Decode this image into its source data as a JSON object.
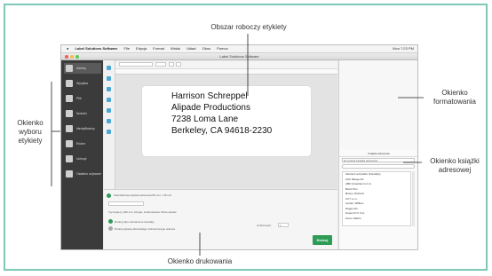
{
  "annotations": {
    "workspace": "Obszar roboczy etykiety",
    "label_selection": [
      "Okienko",
      "wyboru",
      "etykiety"
    ],
    "formatting": [
      "Okienko",
      "formatowania"
    ],
    "address_book": [
      "Okienko książki",
      "adresowej"
    ],
    "print": "Okienko drukowania"
  },
  "menubar": {
    "app": "Label Solutions Software",
    "items": [
      "File",
      "Edycja",
      "Format",
      "Widok",
      "Układ",
      "Okno",
      "Pomoc"
    ],
    "status": "Mon 7:23 PM"
  },
  "window": {
    "title": "Label Solutions Software"
  },
  "sidebar": {
    "items": [
      {
        "label": "Adresy",
        "icon": "address-icon"
      },
      {
        "label": "Wysyłka",
        "icon": "shipping-icon"
      },
      {
        "label": "Plik",
        "icon": "file-icon"
      },
      {
        "label": "Nośniki",
        "icon": "media-icon"
      },
      {
        "label": "Identyfikatory",
        "icon": "id-icon"
      },
      {
        "label": "Różne",
        "icon": "misc-icon"
      },
      {
        "label": "Uchwyt",
        "icon": "holder-icon"
      },
      {
        "label": "Ostatnio używane",
        "icon": "recent-icon"
      }
    ]
  },
  "label": {
    "lines": [
      "Harrison Schreppel",
      "Alipade Productions",
      "7238 Loma Lane",
      "Berkeley, CA 94618-2230"
    ]
  },
  "address_book": {
    "header": "Książka adresowa",
    "selector": "Domyślna książka adresowa",
    "contacts": [
      "Zaznacz wszystkie (Kontakty)",
      "ACF Range AS",
      "ABF Industries G.C.A.",
      "Bond PLC",
      "Brown, Richard",
      "CCY s.r.o.",
      "Carrier, William",
      "Dagos AG",
      "Dupont P.V. S.A.",
      "Kevin, Martin"
    ]
  },
  "print_pane": {
    "media": "Standardowa etykieta adresowa 89 mm × 28 mm",
    "printer_line": "Typ kopiery, 300 mm, Drugie, Jednorazowa: Może wpisać",
    "opt1": "Drukuj tylko zaznaczone kontakty",
    "opt2": "Drukuj etykietę dla każdego zaznaczonego wiersza",
    "copies_label": "Liczba kopii:",
    "copies": "1",
    "print_button": "Drukuj"
  },
  "colors": {
    "accent": "#2e9b57",
    "frame": "#7ec8b8",
    "sidebar": "#3b3b3b"
  }
}
